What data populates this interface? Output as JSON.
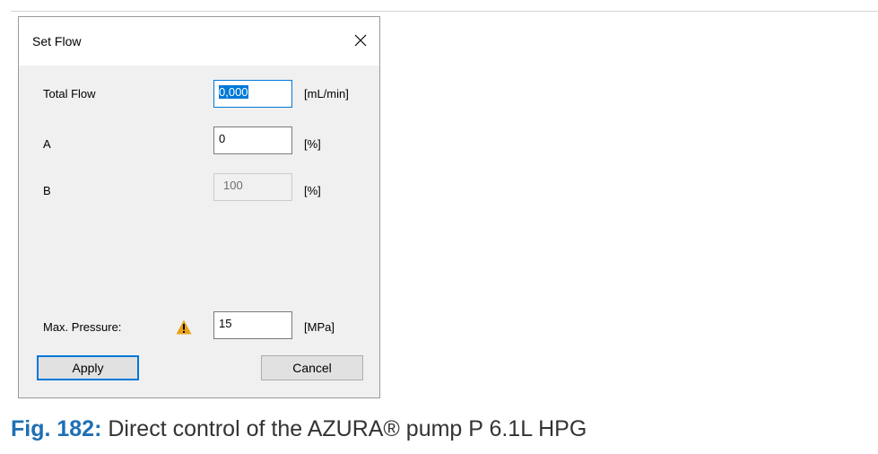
{
  "dialog": {
    "title": "Set Flow",
    "fields": {
      "total_flow": {
        "label": "Total Flow",
        "value": "0,000",
        "unit": "[mL/min]"
      },
      "a": {
        "label": "A",
        "value": "0",
        "unit": "[%]"
      },
      "b": {
        "label": "B",
        "value": "100",
        "unit": "[%]"
      },
      "max_pressure": {
        "label": "Max. Pressure:",
        "value": "15",
        "unit": "[MPa]"
      }
    },
    "buttons": {
      "apply": "Apply",
      "cancel": "Cancel"
    }
  },
  "caption": {
    "figure": "Fig. 182:",
    "text": "Direct control of the AZURA® pump P 6.1L HPG"
  },
  "icons": {
    "close": "close-icon",
    "warning": "warning-icon"
  },
  "colors": {
    "accent": "#0078d7",
    "warning": "#e8a317",
    "caption_figure": "#1e6fb4"
  }
}
